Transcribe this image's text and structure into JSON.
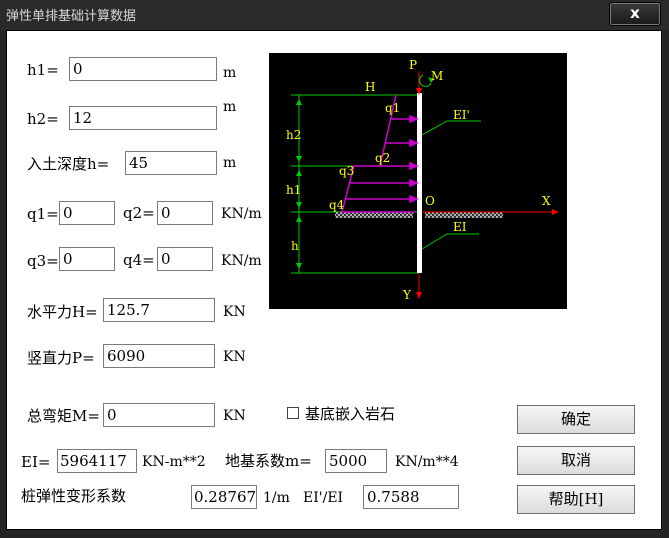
{
  "window": {
    "title": "弹性单排基础计算数据",
    "close_symbol": "x"
  },
  "fields": {
    "h1": {
      "label": "h1=",
      "value": "0",
      "unit": "m"
    },
    "h2": {
      "label": "h2=",
      "value": "12",
      "unit": "m"
    },
    "h": {
      "label": "入土深度h=",
      "value": "45",
      "unit": "m"
    },
    "q1": {
      "label": "q1=",
      "value": "0"
    },
    "q2": {
      "label": "q2=",
      "value": "0",
      "unit": "KN/m"
    },
    "q3": {
      "label": "q3=",
      "value": "0"
    },
    "q4": {
      "label": "q4=",
      "value": "0",
      "unit": "KN/m"
    },
    "H": {
      "label": "水平力H=",
      "value": "125.7",
      "unit": "KN"
    },
    "P": {
      "label": "竖直力P=",
      "value": "6090",
      "unit": "KN"
    },
    "M": {
      "label": "总弯矩M=",
      "value": "0",
      "unit": "KN"
    },
    "EI": {
      "label": "EI=",
      "value": "5964117",
      "unit": "KN-m**2"
    },
    "m": {
      "label": "地基系数m=",
      "value": "5000",
      "unit": "KN/m**4"
    },
    "alpha": {
      "label": "桩弹性变形系数",
      "value": "0.28767",
      "unit": "1/m"
    },
    "ratio": {
      "label": "EI'/EI",
      "value": "0.7588"
    }
  },
  "checkbox": {
    "label": "基底嵌入岩石",
    "checked": false
  },
  "buttons": {
    "ok": "确定",
    "cancel": "取消",
    "help": "帮助[H]"
  },
  "diagram": {
    "labels": {
      "P": "P",
      "M": "M",
      "H": "H",
      "q1": "q1",
      "q2": "q2",
      "q3": "q3",
      "q4": "q4",
      "h2": "h2",
      "h1": "h1",
      "h": "h",
      "EI_upper": "EI'",
      "EI_lower": "EI",
      "O": "O",
      "X": "X",
      "Y": "Y"
    },
    "colors": {
      "background": "#000000",
      "dimension_lines": "#00cc00",
      "load": "#cc00cc",
      "text": "#ffff00",
      "pile": "#ffffff",
      "axes": "#ff0000",
      "soil": "#bbbbbb"
    }
  }
}
